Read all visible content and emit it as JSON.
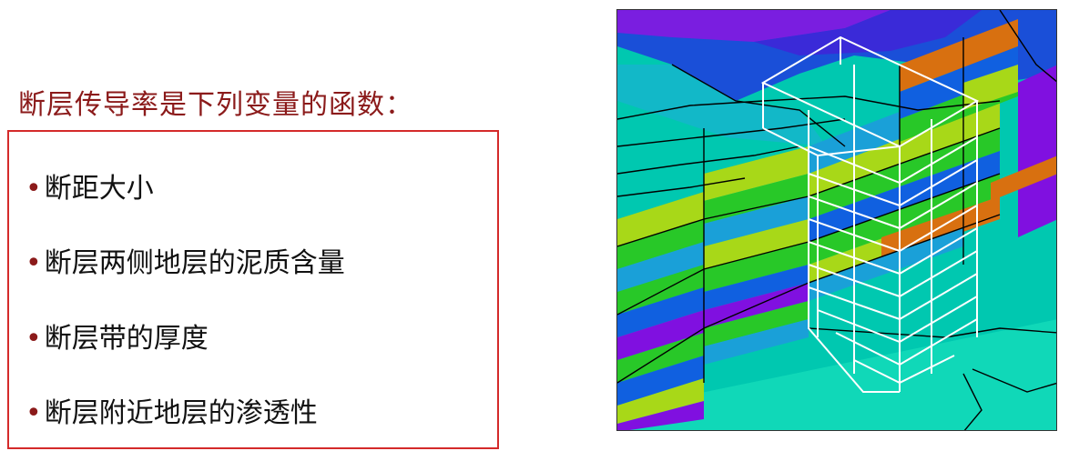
{
  "slide": {
    "heading": "断层传导率是下列变量的函数：",
    "bullet_marker": "•",
    "items": [
      {
        "label": "断距大小"
      },
      {
        "label": "断层两侧地层的泥质含量"
      },
      {
        "label": "断层带的厚度"
      },
      {
        "label": "断层附近地层的渗透性"
      }
    ]
  },
  "colors": {
    "heading": "#8b1a1a",
    "box_border": "#d42a2a",
    "background_teal": "#00c8b0",
    "layer_yellow_green": "#a8d818",
    "layer_green": "#28c828",
    "layer_blue": "#1060e0",
    "layer_purple": "#8010e0",
    "layer_orange": "#d87010",
    "grid_white": "#ffffff"
  }
}
